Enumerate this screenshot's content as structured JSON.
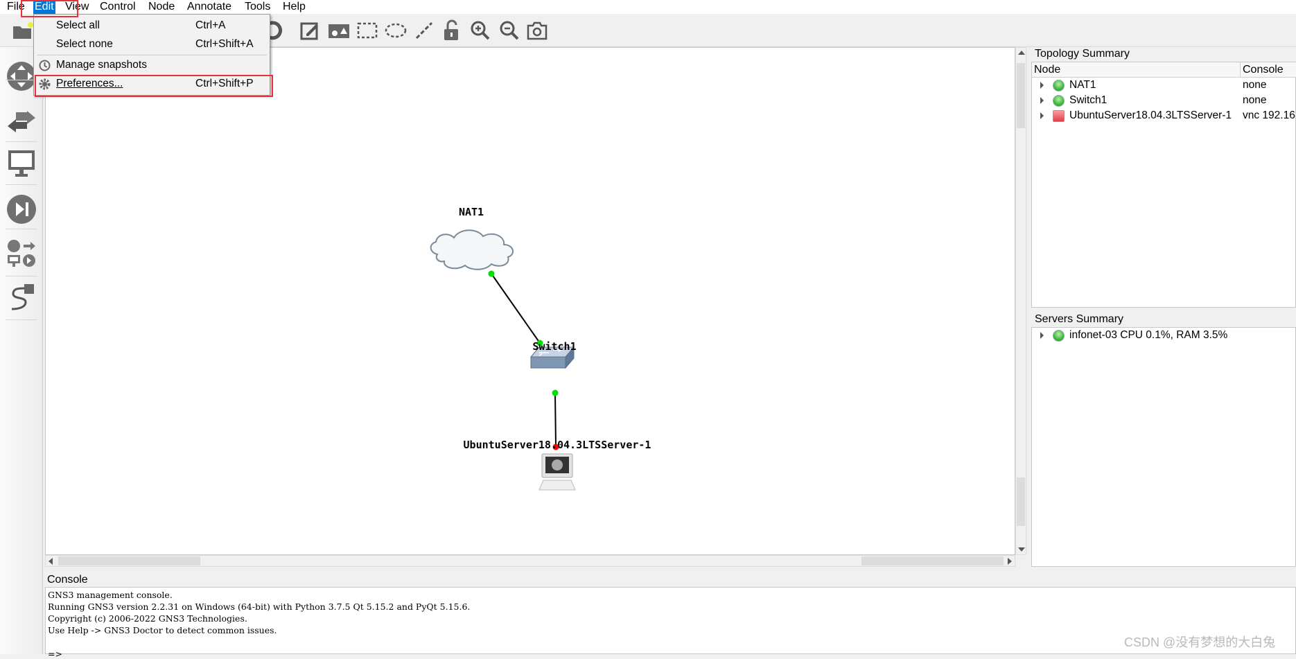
{
  "menubar": {
    "items": [
      "File",
      "Edit",
      "View",
      "Control",
      "Node",
      "Annotate",
      "Tools",
      "Help"
    ],
    "active": "Edit"
  },
  "edit_menu": {
    "items": [
      {
        "label": "Select all",
        "shortcut": "Ctrl+A"
      },
      {
        "label": "Select none",
        "shortcut": "Ctrl+Shift+A"
      },
      {
        "label": "Manage snapshots",
        "shortcut": "",
        "icon": "clock-icon"
      },
      {
        "label": "Preferences...",
        "shortcut": "Ctrl+Shift+P",
        "icon": "gear-icon"
      }
    ]
  },
  "toolbar": {
    "icons": [
      "open-folder-icon",
      "reload-icon",
      "add-note-icon",
      "insert-image-icon",
      "draw-rectangle-icon",
      "draw-ellipse-icon",
      "draw-line-icon",
      "unlock-icon",
      "zoom-in-icon",
      "zoom-out-icon",
      "screenshot-icon"
    ]
  },
  "left_toolbar": {
    "icons": [
      "router-icon",
      "switch-icon",
      "end-device-icon",
      "security-device-icon",
      "all-devices-icon",
      "add-link-icon"
    ]
  },
  "topology": {
    "nodes": [
      {
        "name": "NAT1",
        "type": "cloud"
      },
      {
        "name": "Switch1",
        "type": "switch"
      },
      {
        "name": "UbuntuServer18.04.3LTSServer-1",
        "type": "computer"
      }
    ],
    "links": [
      {
        "from": "NAT1",
        "to": "Switch1",
        "status": [
          "up",
          "up"
        ]
      },
      {
        "from": "Switch1",
        "to": "UbuntuServer18.04.3LTSServer-1",
        "status": [
          "up",
          "down"
        ]
      }
    ]
  },
  "topology_summary": {
    "title": "Topology Summary",
    "columns": [
      "Node",
      "Console"
    ],
    "rows": [
      {
        "node": "NAT1",
        "console": "none",
        "status": "started"
      },
      {
        "node": "Switch1",
        "console": "none",
        "status": "started"
      },
      {
        "node": "UbuntuServer18.04.3LTSServer-1",
        "console": "vnc 192.16",
        "status": "stopped"
      }
    ]
  },
  "servers_summary": {
    "title": "Servers Summary",
    "rows": [
      {
        "text": "infonet-03 CPU 0.1%, RAM 3.5%",
        "status": "started"
      }
    ]
  },
  "console": {
    "title": "Console",
    "lines": [
      "GNS3 management console.",
      "Running GNS3 version 2.2.31 on Windows (64-bit) with Python 3.7.5 Qt 5.15.2 and PyQt 5.15.6.",
      "Copyright (c) 2006-2022 GNS3 Technologies.",
      "Use Help -> GNS3 Doctor to detect common issues.",
      "",
      "=>"
    ]
  },
  "watermark": "CSDN @没有梦想的大白兔",
  "colors": {
    "highlight": "#0078d7",
    "annotation_red": "#e8303a",
    "link_up": "#00e000",
    "link_down": "#ff0000"
  }
}
